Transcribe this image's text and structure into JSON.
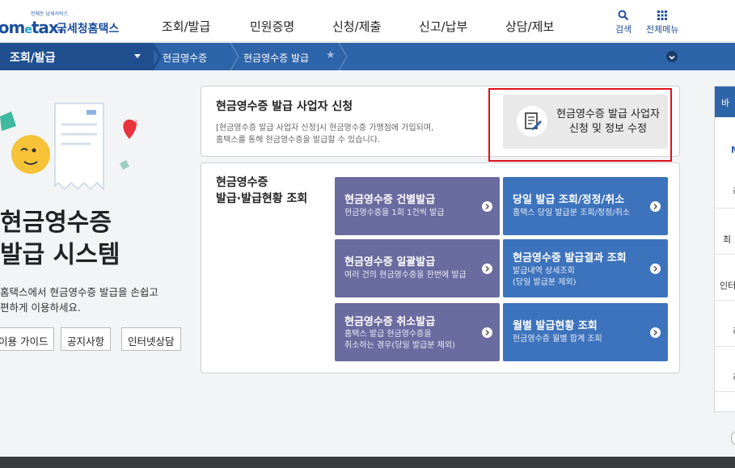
{
  "header": {
    "logo_small": "언제든 납세서비스",
    "logo_latin_a": "Hom",
    "logo_latin_e": "e",
    "logo_latin_b": "tax.",
    "logo_korean": "국세청홈택스",
    "nav": [
      "조회/발급",
      "민원증명",
      "신청/제출",
      "신고/납부",
      "상담/제보"
    ],
    "search_label": "검색",
    "menu_label": "전체메뉴"
  },
  "breadcrumb": {
    "section": "조회/발급",
    "items": [
      "현금영수증",
      "현금영수증 발급"
    ]
  },
  "hero": {
    "title_line1": "현금영수증",
    "title_line2": "발급 시스템",
    "desc_line1": "홈택스에서 현금영수증 발급을 손쉽고",
    "desc_line2": "편하게 이용하세요.",
    "buttons": [
      "이용 가이드",
      "공지사항",
      "인터넷상담"
    ]
  },
  "apply_panel": {
    "title": "현금영수증 발급 사업자 신청",
    "desc_line1": "[현금영수증 발급 사업자 신청]시 현금영수증 가맹점에 가입되며,",
    "desc_line2": "홈택스를 통해 현금영수증을 발급할 수 있습니다.",
    "button_line1": "현금영수증 발급 사업자",
    "button_line2": "신청 및 정보 수정"
  },
  "issue_panel": {
    "title_line1": "현금영수증",
    "title_line2": "발급·발급현황 조회",
    "tiles": [
      {
        "title": "현금영수증 건별발급",
        "sub1": "현금영수증을 1회 1건씩 발급",
        "sub2": ""
      },
      {
        "title": "당일 발급 조회/정정/취소",
        "sub1": "홈택스 당일 발급분 조회/정정/취소",
        "sub2": ""
      },
      {
        "title": "현금영수증 일괄발급",
        "sub1": "여러 건의 현금영수증을 한번에 발급",
        "sub2": ""
      },
      {
        "title": "현금영수증 발급결과 조회",
        "sub1": "발급내역 상세조회",
        "sub2": "(당일 발급분 제외)"
      },
      {
        "title": "현금영수증 취소발급",
        "sub1": "홈택스 발급 현금영수증을",
        "sub2": "취소하는 경우(당일 발급분 제외)"
      },
      {
        "title": "월별 발급현황 조회",
        "sub1": "현금영수증 월별 합계 조회",
        "sub2": ""
      }
    ]
  },
  "right_sidebar": {
    "head": "바",
    "items": [
      "M",
      "즉",
      "최",
      "인터",
      "즉",
      "즉"
    ]
  },
  "colors": {
    "brand_blue": "#2e64a9",
    "tile_purple": "#6a6b9f",
    "tile_blue": "#3d73bd",
    "highlight_red": "#e0121b"
  }
}
